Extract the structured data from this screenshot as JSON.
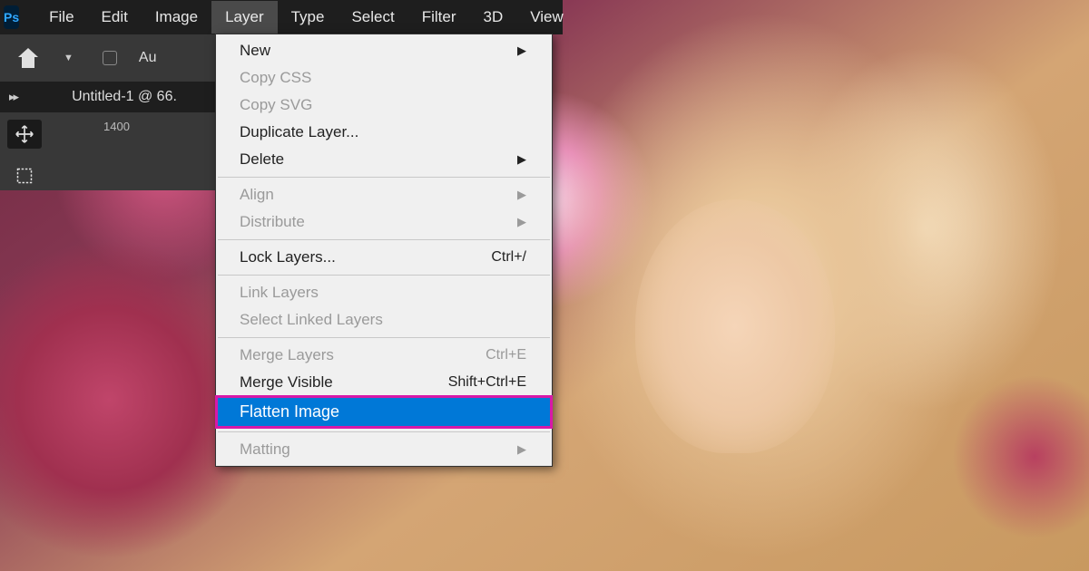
{
  "app": {
    "logo_text": "Ps"
  },
  "menubar": {
    "items": [
      "File",
      "Edit",
      "Image",
      "Layer",
      "Type",
      "Select",
      "Filter",
      "3D",
      "View"
    ],
    "active_index": 3
  },
  "options_bar": {
    "auto_label": "Au"
  },
  "document": {
    "tab_title": "Untitled-1 @ 66."
  },
  "ruler": {
    "tick_label": "1400"
  },
  "dropdown": {
    "items": [
      {
        "label": "New",
        "submenu": true,
        "disabled": false
      },
      {
        "label": "Copy CSS",
        "disabled": true
      },
      {
        "label": "Copy SVG",
        "disabled": true
      },
      {
        "label": "Duplicate Layer...",
        "disabled": false
      },
      {
        "label": "Delete",
        "submenu": true,
        "disabled": false
      },
      {
        "sep": true
      },
      {
        "label": "Align",
        "submenu": true,
        "disabled": true
      },
      {
        "label": "Distribute",
        "submenu": true,
        "disabled": true
      },
      {
        "sep": true
      },
      {
        "label": "Lock Layers...",
        "shortcut": "Ctrl+/",
        "disabled": false
      },
      {
        "sep": true
      },
      {
        "label": "Link Layers",
        "disabled": true
      },
      {
        "label": "Select Linked Layers",
        "disabled": true
      },
      {
        "sep": true
      },
      {
        "label": "Merge Layers",
        "shortcut": "Ctrl+E",
        "disabled": true
      },
      {
        "label": "Merge Visible",
        "shortcut": "Shift+Ctrl+E",
        "disabled": false
      },
      {
        "label": "Flatten Image",
        "highlighted": true,
        "disabled": false
      },
      {
        "sep": true
      },
      {
        "label": "Matting",
        "submenu": true,
        "disabled": true
      }
    ]
  }
}
